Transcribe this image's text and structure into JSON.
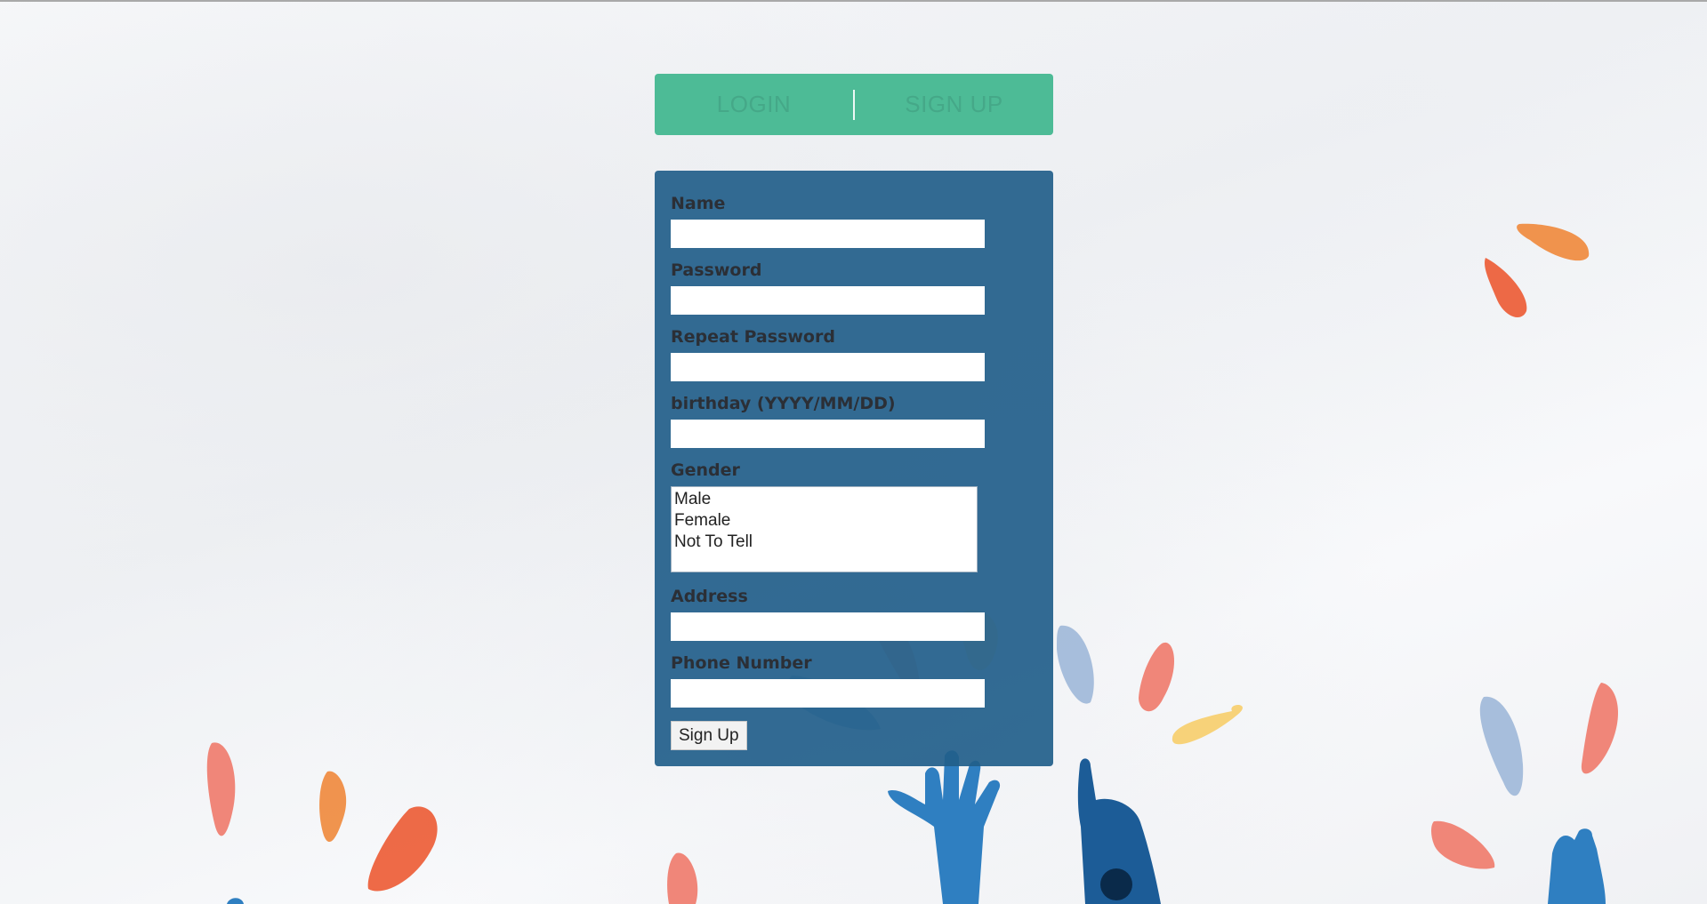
{
  "tabs": {
    "login": "LOGIN",
    "signup": "SIGN UP"
  },
  "form": {
    "name_label": "Name",
    "password_label": "Password",
    "repeat_password_label": "Repeat Password",
    "birthday_label": "birthday (YYYY/MM/DD)",
    "gender_label": "Gender",
    "gender_options": [
      "Male",
      "Female",
      "Not To Tell"
    ],
    "address_label": "Address",
    "phone_label": "Phone Number",
    "submit_label": "Sign Up"
  },
  "colors": {
    "tabbar": "#4dbb96",
    "panel": "#225e8a",
    "accent_orange": "#ee6a3c",
    "accent_blue": "#2f7fc1"
  }
}
